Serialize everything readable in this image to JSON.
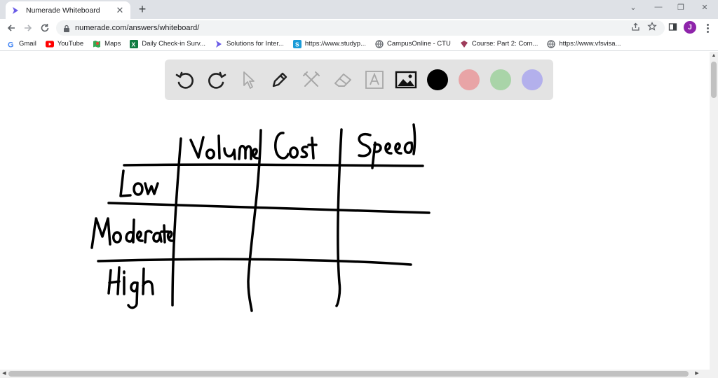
{
  "browser": {
    "tab_title": "Numerade Whiteboard",
    "url": "numerade.com/answers/whiteboard/",
    "profile_initial": "J",
    "bookmarks": [
      {
        "label": "Gmail",
        "icon": "google-icon"
      },
      {
        "label": "YouTube",
        "icon": "youtube-icon"
      },
      {
        "label": "Maps",
        "icon": "maps-icon"
      },
      {
        "label": "Daily Check-in Surv...",
        "icon": "excel-icon"
      },
      {
        "label": "Solutions for Inter...",
        "icon": "numerade-icon"
      },
      {
        "label": "https://www.studyp...",
        "icon": "studyp-icon"
      },
      {
        "label": "CampusOnline - CTU",
        "icon": "globe-icon"
      },
      {
        "label": "Course: Part 2: Com...",
        "icon": "course-icon"
      },
      {
        "label": "https://www.vfsvisa...",
        "icon": "globe-icon"
      }
    ]
  },
  "whiteboard": {
    "tools": [
      "undo-icon",
      "redo-icon",
      "pointer-icon",
      "pen-icon",
      "tools-icon",
      "eraser-icon",
      "text-icon",
      "image-icon"
    ],
    "colors": [
      "#000000",
      "#e8a4a6",
      "#a9d4a8",
      "#b3b0ec"
    ],
    "handwriting": {
      "col_headers": [
        "Volume",
        "Cost",
        "Speed"
      ],
      "row_headers": [
        "Low",
        "Moderate",
        "High"
      ]
    }
  }
}
